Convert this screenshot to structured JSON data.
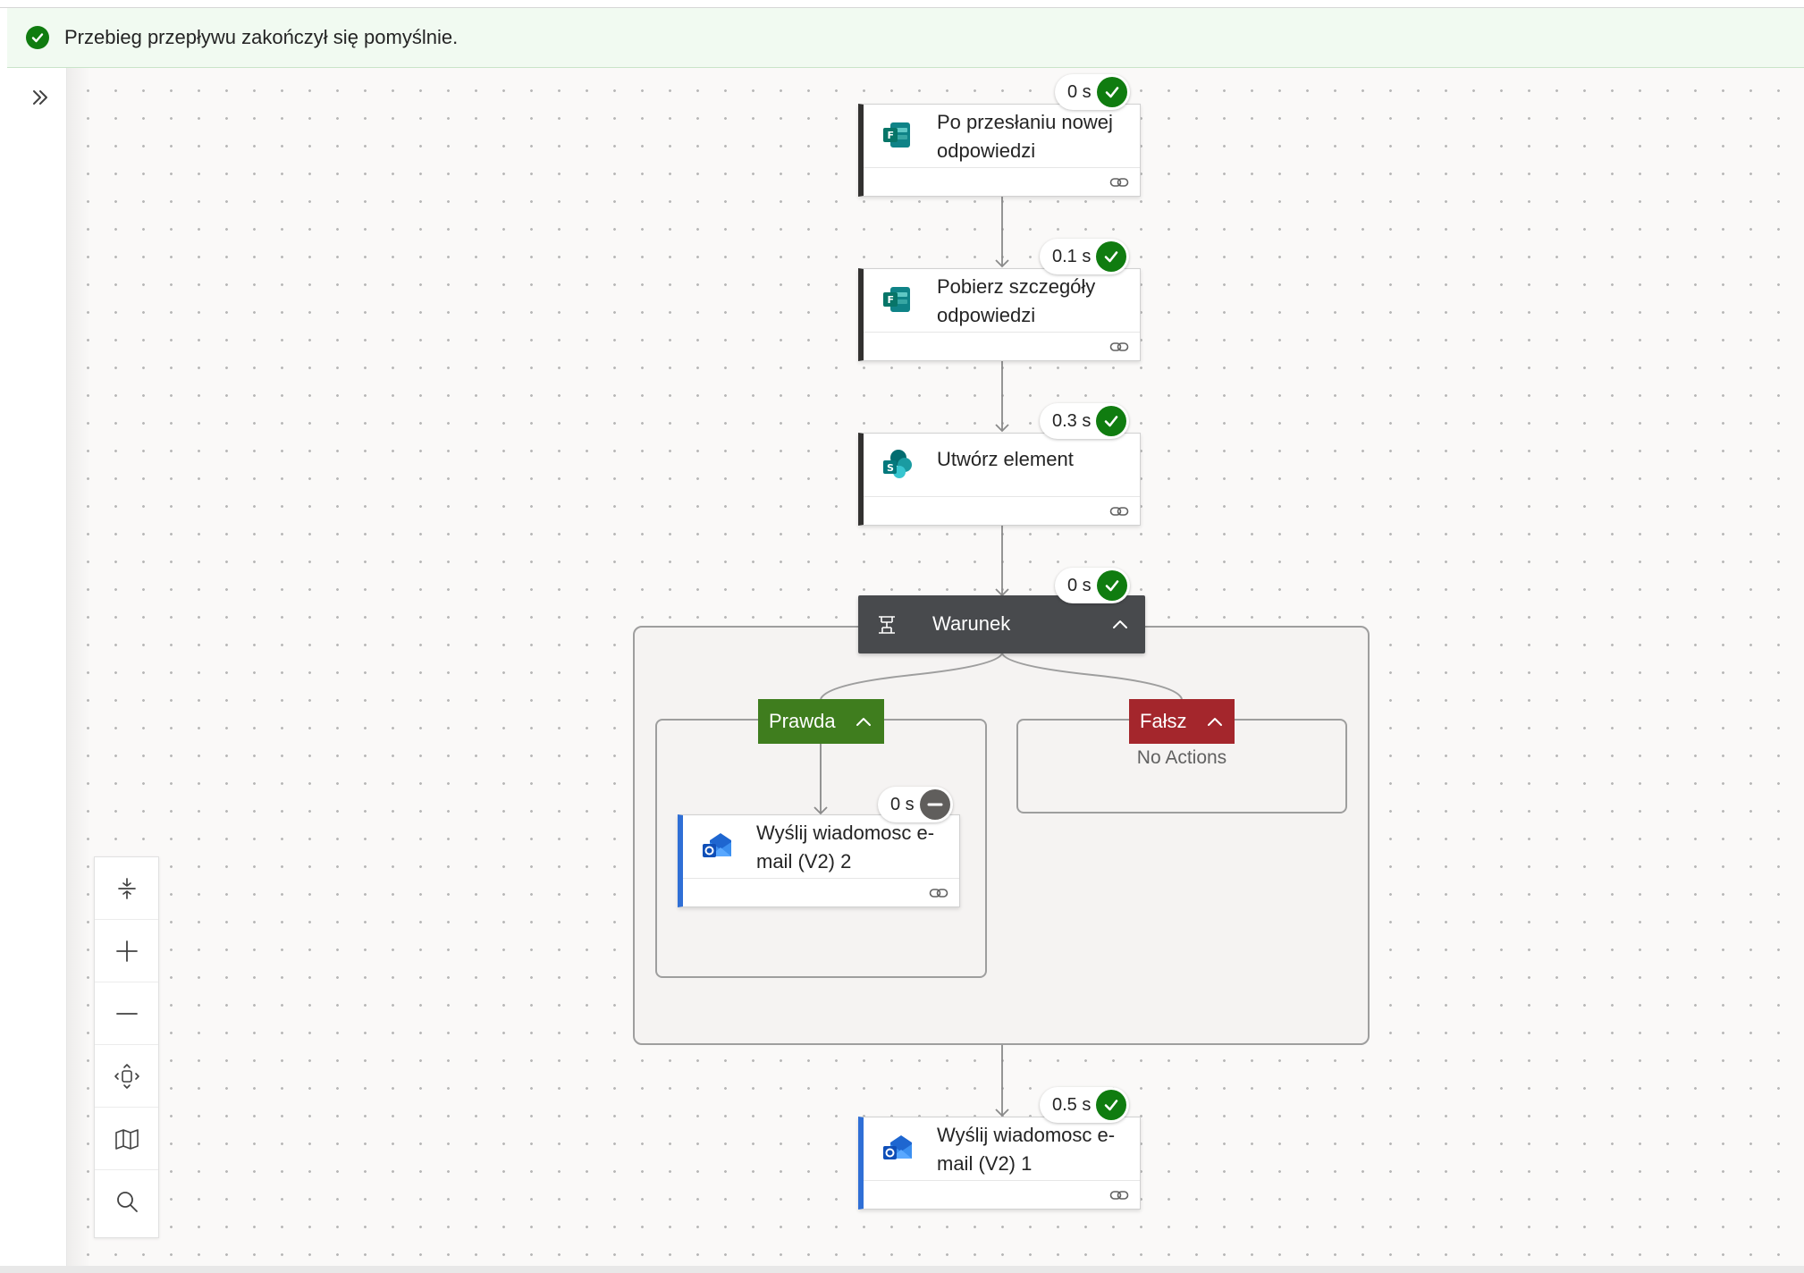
{
  "banner": {
    "message": "Przebieg przepływu zakończył się pomyślnie.",
    "status_color": "#107c10"
  },
  "icons": {
    "banner": "success-check-icon",
    "expand": "chevron-double-right-icon",
    "forms": "microsoft-forms-icon",
    "sharepoint": "sharepoint-icon",
    "outlook": "outlook-icon",
    "condition": "condition-icon",
    "link": "link-icon",
    "zoom_tools": [
      "fit-vertical-icon",
      "zoom-in-icon",
      "zoom-out-icon",
      "fit-view-icon",
      "minimap-icon",
      "search-icon"
    ]
  },
  "steps": [
    {
      "title": "Po przesłaniu nowej odpowiedzi",
      "duration": "0 s",
      "status": "succeeded"
    },
    {
      "title": "Pobierz szczegóły odpowiedzi",
      "duration": "0.1 s",
      "status": "succeeded"
    },
    {
      "title": "Utwórz element",
      "duration": "0.3 s",
      "status": "succeeded"
    }
  ],
  "condition": {
    "title": "Warunek",
    "duration": "0 s",
    "status": "succeeded",
    "true_branch": {
      "label": "Prawda",
      "action": {
        "title": "Wyślij wiadomosc e-mail (V2) 2",
        "duration": "0 s",
        "status": "skipped"
      }
    },
    "false_branch": {
      "label": "Fałsz",
      "empty_text": "No Actions"
    }
  },
  "final_step": {
    "title": "Wyślij wiadomosc e-mail (V2) 1",
    "duration": "0.5 s",
    "status": "succeeded"
  },
  "colors": {
    "success": "#107c10",
    "skipped": "#605e5c",
    "true_branch": "#3f7d1e",
    "false_branch": "#a4262c",
    "condition_header": "#484a4d",
    "outlook_accent": "#2f6fd6"
  }
}
